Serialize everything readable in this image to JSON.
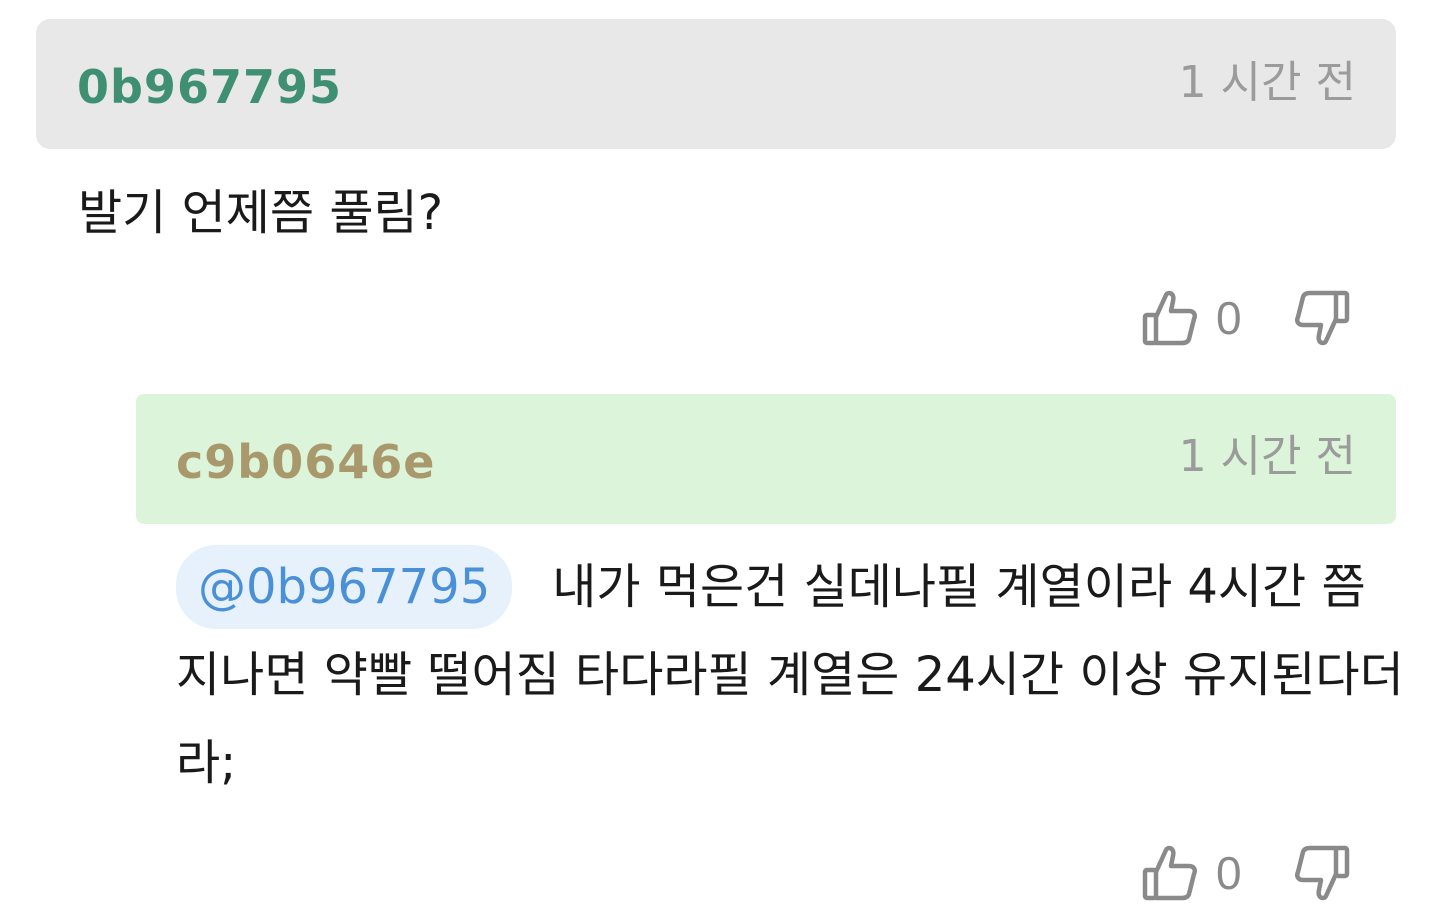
{
  "comment": {
    "username": "0b967795",
    "time": "1 시간 전",
    "text": "발기 언제쯤 풀림?",
    "likes": "0"
  },
  "reply": {
    "username": "c9b0646e",
    "time": "1 시간 전",
    "mention": "@0b967795",
    "text": "내가 먹은건 실데나필 계열이라 4시간 쯤 지나면 약빨 떨어짐 타다라필 계열은 24시간 이상 유지된다더라;",
    "likes": "0"
  },
  "icons": {
    "like": "thumbs-up-icon",
    "dislike": "thumbs-down-icon"
  },
  "colors": {
    "top_header_bg": "#e8e8e8",
    "reply_header_bg": "#dcf4da",
    "top_username": "#3f8f73",
    "reply_username": "#a8986c",
    "mention_bg": "#e6f1fb",
    "mention_text": "#4a90d9"
  }
}
